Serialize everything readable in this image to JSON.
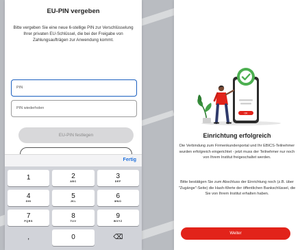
{
  "pin_screen": {
    "title": "EU-PIN vergeben",
    "description": "Bitte vergeben Sie eine neue 6-stellige PIN zur Verschlüsselung Ihrer privaten EU-Schlüssel, die bei der Freigabe von Zahlungsaufträgen zur Anwendung kommt.",
    "pin_field_label": "PIN",
    "pin_repeat_placeholder": "PIN wiederholen",
    "set_pin_button": "EU-PIN festlegen",
    "keyboard_done": "Fertig",
    "keys": [
      {
        "digit": "1",
        "letters": ""
      },
      {
        "digit": "2",
        "letters": "ABC"
      },
      {
        "digit": "3",
        "letters": "DEF"
      },
      {
        "digit": "4",
        "letters": "GHI"
      },
      {
        "digit": "5",
        "letters": "JKL"
      },
      {
        "digit": "6",
        "letters": "MNO"
      },
      {
        "digit": "7",
        "letters": "PQRS"
      },
      {
        "digit": "8",
        "letters": "TUV"
      },
      {
        "digit": "9",
        "letters": "WXYZ"
      },
      {
        "digit": ",",
        "letters": ""
      },
      {
        "digit": "0",
        "letters": ""
      },
      {
        "digit": "⌫",
        "letters": ""
      }
    ]
  },
  "success_screen": {
    "title": "Einrichtung erfolgreich",
    "paragraph1": "Die Verbindung zum Firmenkundenportal und Ihr EBICS-Teilnehmer wurden erfolgreich eingerichtet - jetzt muss der Teilnehmer nur noch von Ihrem Institut freigeschaltet werden.",
    "paragraph2": "Bitte bestätigen Sie zum Abschluss der Einrichtung noch (z.B. über \"Zugänge\"-Seite) die Hash-Werte der öffentlichen Bankschlüssel, die Sie von Ihrem Institut erhalten haben.",
    "continue_button": "Weiter",
    "phone_button_label": "OK"
  },
  "colors": {
    "accent_red": "#e2231a",
    "focus_blue": "#1a5fbf",
    "check_green": "#4caf50"
  }
}
